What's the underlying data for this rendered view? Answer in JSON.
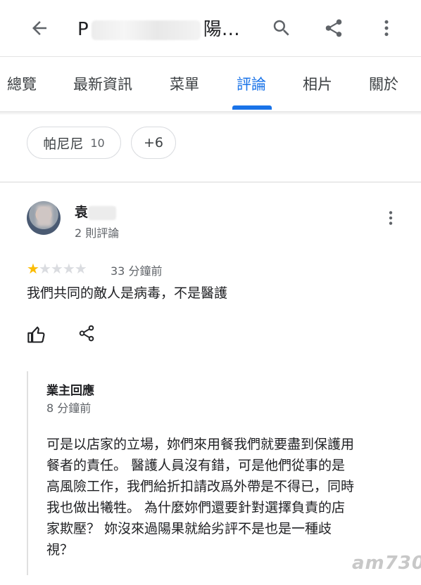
{
  "appbar": {
    "title_prefix": "P",
    "title_suffix": "陽…",
    "icons": [
      "back-arrow-icon",
      "search-icon",
      "share-icon",
      "more-vert-icon"
    ]
  },
  "tabs": [
    {
      "label": "總覽",
      "active": false
    },
    {
      "label": "最新資訊",
      "active": false
    },
    {
      "label": "菜單",
      "active": false
    },
    {
      "label": "評論",
      "active": true
    },
    {
      "label": "相片",
      "active": false
    },
    {
      "label": "關於",
      "active": false
    }
  ],
  "filters": {
    "chip1": {
      "label": "帕尼尼",
      "count": "10"
    },
    "chip2": {
      "label": "+6"
    }
  },
  "review": {
    "reviewer_name": "袁",
    "reviewer_meta": "2 則評論",
    "rating": 1,
    "rating_max": 5,
    "time": "33 分鐘前",
    "text": "我們共同的敵人是病毒，不是醫護"
  },
  "owner_reply": {
    "title": "業主回應",
    "time": "8 分鐘前",
    "lines": [
      "可是以店家的立場，妳們來用餐我們就要盡到保護用",
      "餐者的責任。 醫護人員沒有錯，可是他們從事的是",
      "高風險工作，我們給折扣請改爲外帶是不得已，同時",
      "我也做出犧牲。 為什麼妳們還要針對選擇負責的店",
      "家欺壓？ 妳沒來過陽果就給劣評不是也是一種歧",
      "視？"
    ]
  },
  "watermark": "am730",
  "colors": {
    "accent": "#1a73e8",
    "star": "#fbbc04",
    "star_empty": "#dadce0"
  }
}
